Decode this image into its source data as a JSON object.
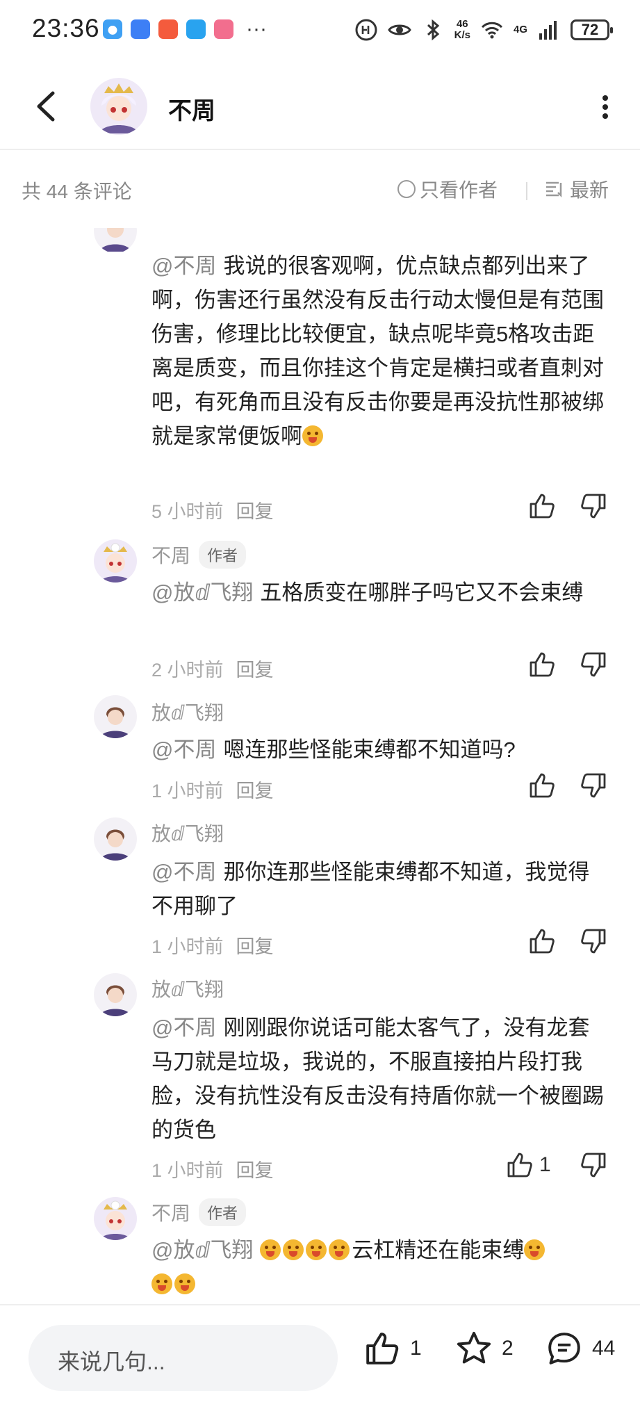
{
  "status_bar": {
    "time": "23:36",
    "dots": "···",
    "speed_value": "46",
    "speed_unit": "K/s",
    "network": "4G",
    "battery": "72"
  },
  "header": {
    "title": "不周"
  },
  "toolbar": {
    "count": "共 44 条评论",
    "only_author": "只看作者",
    "sort": "最新"
  },
  "comments": [
    {
      "mention": "@不周",
      "text": "我说的很客观啊，优点缺点都列出来了啊，伤害还行虽然没有反击行动太慢但是有范围伤害，修理比比较便宜，缺点呢毕竟5格攻击距离是质变，而且你挂这个肯定是横扫或者直刺对吧，有死角而且没有反击你要是再没抗性那被绑就是家常便饭啊",
      "time": "5 小时前",
      "reply": "回复"
    },
    {
      "user": "不周",
      "badge": "作者",
      "mention": "@放ⅆ飞翔",
      "text": "五格质变在哪胖子吗它又不会束缚",
      "time": "2 小时前",
      "reply": "回复"
    },
    {
      "user": "放ⅆ飞翔",
      "mention": "@不周",
      "text": "嗯连那些怪能束缚都不知道吗?",
      "time": "1 小时前",
      "reply": "回复"
    },
    {
      "user": "放ⅆ飞翔",
      "mention": "@不周",
      "text": "那你连那些怪能束缚都不知道，我觉得不用聊了",
      "time": "1 小时前",
      "reply": "回复"
    },
    {
      "user": "放ⅆ飞翔",
      "mention": "@不周",
      "text": "刚刚跟你说话可能太客气了，没有龙套马刀就是垃圾，我说的，不服直接拍片段打我脸，没有抗性没有反击没有持盾你就一个被圈踢的货色",
      "time": "1 小时前",
      "reply": "回复",
      "likes": "1"
    },
    {
      "user": "不周",
      "badge": "作者",
      "mention": "@放ⅆ飞翔",
      "text": "云杠精还在能束缚"
    }
  ],
  "bottom_bar": {
    "placeholder": "来说几句...",
    "likes": "1",
    "favorites": "2",
    "comments": "44"
  },
  "colors": {
    "text": "#222222",
    "muted": "#999999",
    "divider": "#eeeeee",
    "input_bg": "#f3f4f6"
  }
}
